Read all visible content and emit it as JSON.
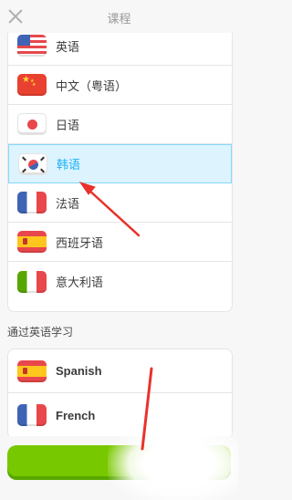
{
  "header": {
    "title": "课程"
  },
  "languages": [
    {
      "label": "英语",
      "flag": "us-flag-icon"
    },
    {
      "label": "中文（粤语）",
      "flag": "china-flag-icon"
    },
    {
      "label": "日语",
      "flag": "japan-flag-icon"
    },
    {
      "label": "韩语",
      "flag": "korea-flag-icon",
      "selected": true
    },
    {
      "label": "法语",
      "flag": "france-flag-icon"
    },
    {
      "label": "西班牙语",
      "flag": "spain-flag-icon"
    },
    {
      "label": "意大利语",
      "flag": "italy-flag-icon"
    }
  ],
  "english_section": {
    "title": "通过英语学习",
    "items": [
      {
        "label": "Spanish",
        "flag": "spain-flag-icon"
      },
      {
        "label": "French",
        "flag": "france-flag-icon"
      }
    ]
  },
  "colors": {
    "selected_bg": "#ddf4ff",
    "selected_border": "#84d8ff",
    "selected_text": "#1cb0f6",
    "cta_green": "#78c800",
    "annotation_red": "#e8322a"
  }
}
